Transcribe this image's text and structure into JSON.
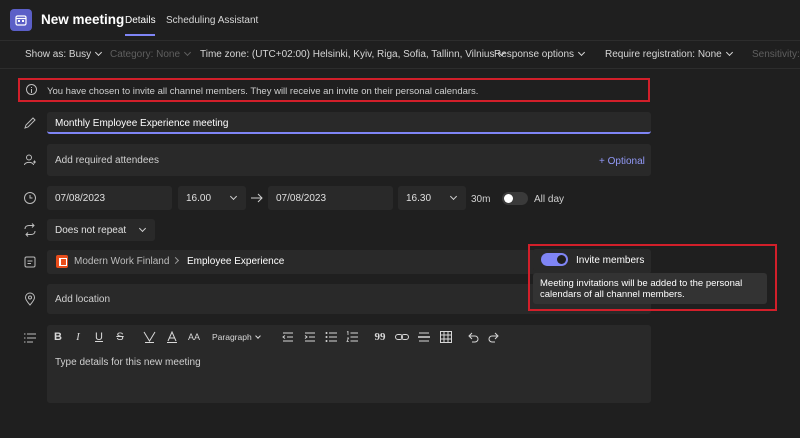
{
  "header": {
    "title": "New meeting",
    "tabs": [
      {
        "label": "Details",
        "active": true
      },
      {
        "label": "Scheduling Assistant",
        "active": false
      }
    ],
    "accent_color": "#5b5fc7"
  },
  "toolbar": {
    "show_as": "Show as: Busy",
    "category": "Category: None",
    "time_zone": "Time zone: (UTC+02:00) Helsinki, Kyiv, Riga, Sofia, Tallinn, Vilnius",
    "response_options": "Response options",
    "require_registration": "Require registration: None",
    "sensitivity": "Sensitivity:"
  },
  "banner": {
    "text": "You have chosen to invite all channel members. They will receive an invite on their personal calendars.",
    "icon": "info-icon",
    "highlight_color": "#d21f2a"
  },
  "form": {
    "title_value": "Monthly Employee Experience meeting",
    "attendees_placeholder": "Add required attendees",
    "optional_link": "+ Optional",
    "start_date": "07/08/2023",
    "start_time": "16.00",
    "end_date": "07/08/2023",
    "end_time": "16.30",
    "duration": "30m",
    "all_day_label": "All day",
    "all_day_on": false,
    "repeat_value": "Does not repeat",
    "team_name": "Modern Work Finland",
    "channel_name": "Employee Experience",
    "location_placeholder": "Add location",
    "details_placeholder": "Type details for this new meeting"
  },
  "editor_toolbar": {
    "bold": "B",
    "italic": "I",
    "underline": "U",
    "strike": "S",
    "font_size": "AA",
    "paragraph": "Paragraph",
    "quote": "99"
  },
  "invite_popup": {
    "toggle_label": "Invite members",
    "toggle_on": true,
    "tooltip": "Meeting invitations will be added to the personal calendars of all channel members."
  }
}
